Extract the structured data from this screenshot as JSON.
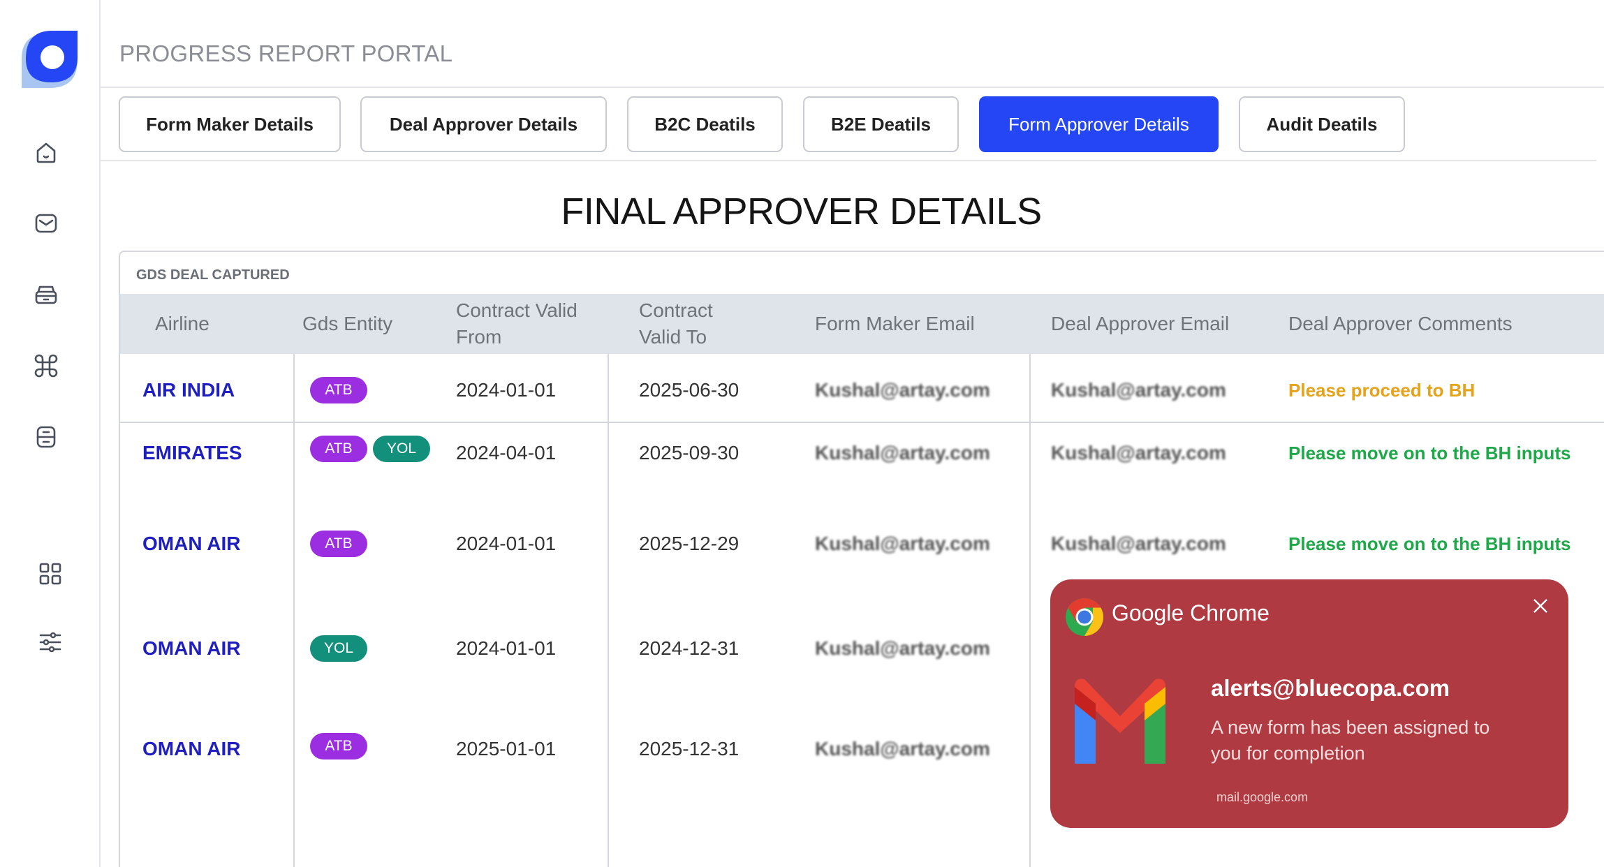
{
  "app": {
    "title": "PROGRESS REPORT PORTAL"
  },
  "sidebar": {
    "icons": [
      "home-icon",
      "inbox-icon",
      "archive-icon",
      "command-icon",
      "document-icon",
      "grid-icon",
      "sliders-icon"
    ]
  },
  "tabs": [
    {
      "label": "Form Maker Details",
      "active": false
    },
    {
      "label": "Deal Approver Details",
      "active": false
    },
    {
      "label": "B2C Deatils",
      "active": false
    },
    {
      "label": "B2E Deatils",
      "active": false
    },
    {
      "label": "Form Approver Details",
      "active": true
    },
    {
      "label": "Audit Deatils",
      "active": false
    }
  ],
  "section": {
    "title": "FINAL APPROVER DETAILS"
  },
  "table": {
    "card_label": "GDS DEAL CAPTURED",
    "headers": {
      "airline": "Airline",
      "gds_entity": "Gds Entity",
      "valid_from_1": "Contract Valid",
      "valid_from_2": "From",
      "valid_to_1": "Contract",
      "valid_to_2": "Valid To",
      "maker_email": "Form Maker Email",
      "approver_email": "Deal Approver Email",
      "approver_comments": "Deal Approver Comments"
    },
    "rows": [
      {
        "airline": "AIR INDIA",
        "gds": [
          "ATB"
        ],
        "from": "2024-01-01",
        "to": "2025-06-30",
        "maker_email": "Kushal@artay.com",
        "approver_email": "Kushal@artay.com",
        "comment": "Please proceed to BH"
      },
      {
        "airline": "EMIRATES",
        "gds": [
          "ATB",
          "YOL"
        ],
        "from": "2024-04-01",
        "to": "2025-09-30",
        "maker_email": "Kushal@artay.com",
        "approver_email": "Kushal@artay.com",
        "comment": "Please move on to the BH inputs"
      },
      {
        "airline": "OMAN AIR",
        "gds": [
          "ATB"
        ],
        "from": "2024-01-01",
        "to": "2025-12-29",
        "maker_email": "Kushal@artay.com",
        "approver_email": "Kushal@artay.com",
        "comment": "Please move on to the BH inputs"
      },
      {
        "airline": "OMAN AIR",
        "gds": [
          "YOL"
        ],
        "from": "2024-01-01",
        "to": "2024-12-31",
        "maker_email": "Kushal@artay.com",
        "approver_email": "",
        "comment": ""
      },
      {
        "airline": "OMAN AIR",
        "gds": [
          "ATB"
        ],
        "from": "2025-01-01",
        "to": "2025-12-31",
        "maker_email": "Kushal@artay.com",
        "approver_email": "",
        "comment": ""
      }
    ]
  },
  "notification": {
    "app": "Google Chrome",
    "sender": "alerts@bluecopa.com",
    "body": "A new form has been assigned to you for completion",
    "source": "mail.google.com"
  },
  "colors": {
    "accent": "#2446f5",
    "airline": "#1f1fbf",
    "badge_atb": "#9a2ee0",
    "badge_yol": "#12907c",
    "comment_yellow": "#e3a31a",
    "comment_green": "#1fa84a",
    "notification_bg": "#b03a41"
  }
}
